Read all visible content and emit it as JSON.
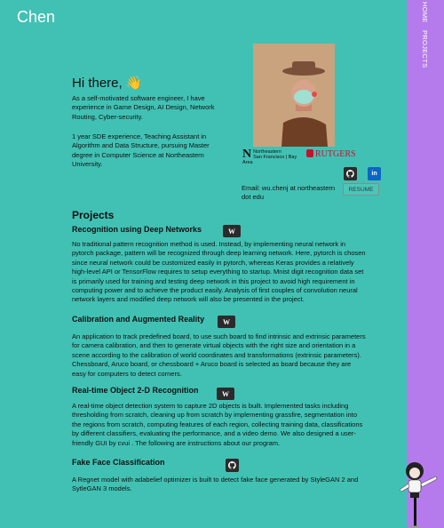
{
  "site": {
    "brand": "Chen"
  },
  "nav": {
    "items": [
      "HOME",
      "PROJECTS"
    ]
  },
  "intro": {
    "greeting": "Hi there, 👋",
    "para1": "As a self-motivated software engineer, I have experience in Game Design, AI Design, Network Routing, Cyber-security.",
    "para2": "1 year SDE experience, Teaching Assistant in Algorithm and Data Structure, pursuing Master degree in Computer Science at Northeastern University."
  },
  "logos": {
    "northeastern_letter": "N",
    "northeastern_text": "Northeastern",
    "northeastern_campus": "San Francisco | Bay Area",
    "rutgers": "RUTGERS"
  },
  "contact": {
    "email": "Email: wu.chenj at northeastern dot edu",
    "resume_label": "RESUME",
    "linkedin_label": "in"
  },
  "projects": {
    "heading": "Projects",
    "items": [
      {
        "title": "Recognition using Deep Networks",
        "button": "W",
        "desc": "No traditional pattern recognition method is used. Instead, by implementing neural network in pytorch package, pattern will be recognized through deep learning network. Here, pytorch is chosen since neural network could be customized easily in pytorch, whereas Keras provides a relatively high-level API or TensorFlow requires to setup everything to startup. Mnist digit recognition data set is primarily used for training and testing deep network in this project to avoid high requirement in computing power and to achieve the product easily. Analysis of first couples of convolution neural network layers and modified deep network will also be presented in the project."
      },
      {
        "title": "Calibration and Augmented Reality",
        "button": "W",
        "desc": "An application to track predefined board, to use such board to find intrinsic and extrinsic parameters for camera calibration, and then to generate virtual objects with the right size and orientation in a scene according to the calibration of world coordinates and transformations (extrinsic parameters). Chessboard, Aruco board, or chessboard + Aruco board is selected as board because they are easy for computers to detect corners."
      },
      {
        "title": "Real-time Object 2-D Recognition",
        "button": "W",
        "desc": "A real-time object detection system to capture 2D objects is built. Implemented tasks including thresholding from scratch, cleaning up from scratch by implementing grassfire, segmentation into the regions from scratch, computing features of each region, collecting training data, classifications by different classifiers, evaluating the performance, and a video demo. We also designed a user-friendly GUI by cvui . The following are instructions about our program."
      },
      {
        "title": "Fake Face Classification",
        "button": "",
        "desc": "A Regnet model with adabelief optimizer is built to detect fake face generated by StyleGAN 2 and SytleGAN 3 models."
      }
    ]
  },
  "colors": {
    "background": "#41c1b4",
    "sidebar": "#b57bec",
    "linkedin": "#0a66c2",
    "dark_button": "#2b2b2b"
  },
  "icons": {
    "github": "github-icon",
    "linkedin": "linkedin-icon",
    "writeup": "w-icon"
  }
}
